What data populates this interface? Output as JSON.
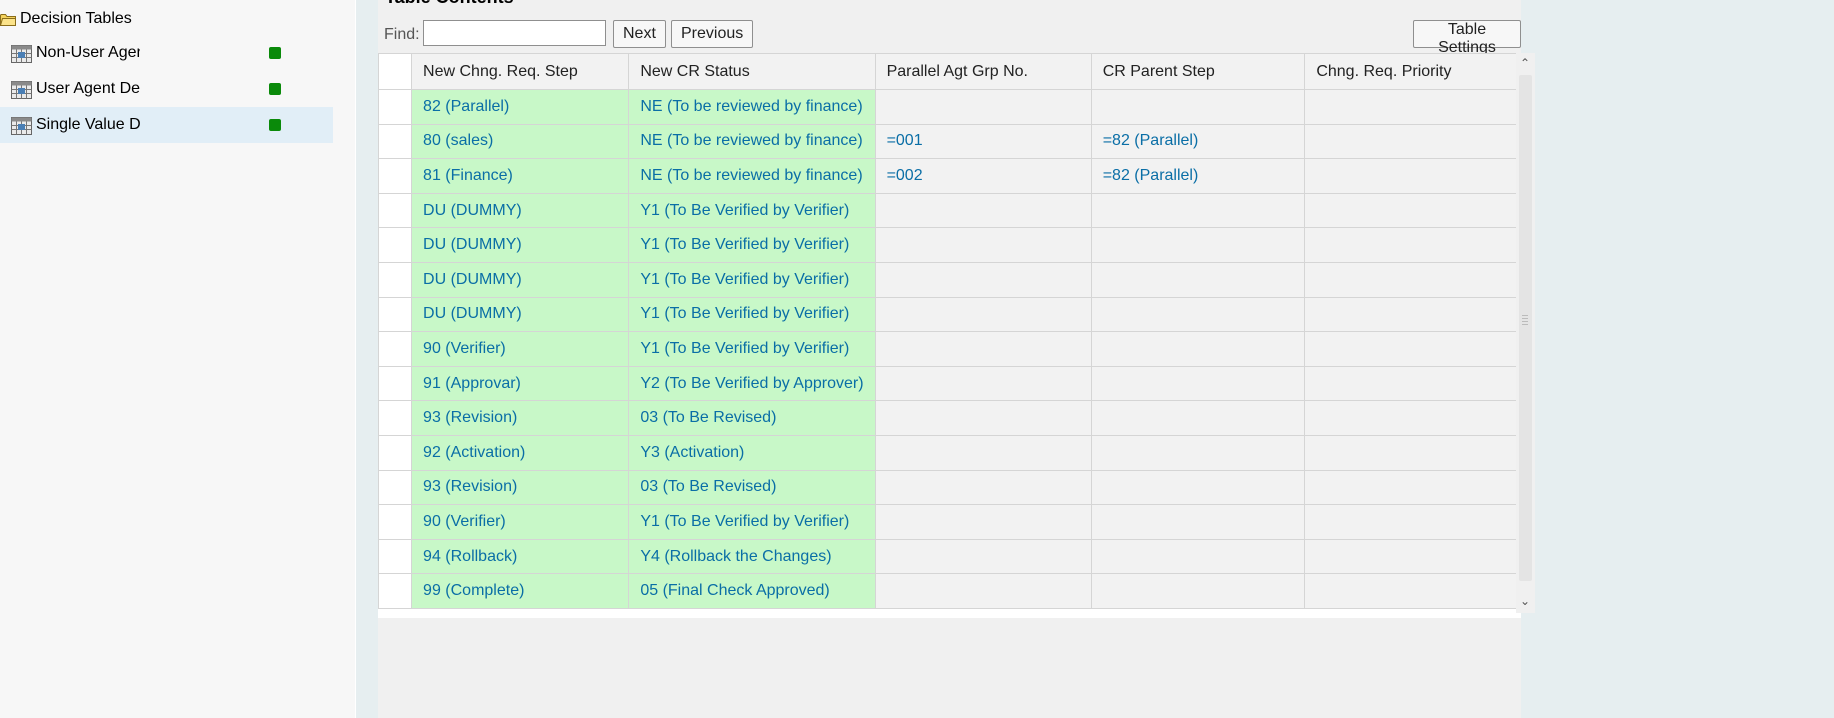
{
  "tree": {
    "root_label": "Decision Tables",
    "items": [
      {
        "label": "Non-User Agent Decision Table",
        "status_color": "#0a8a0a"
      },
      {
        "label": "User Agent Decision Table",
        "status_color": "#0a8a0a"
      },
      {
        "label": "Single Value Decision Table",
        "status_color": "#0a8a0a"
      }
    ]
  },
  "content": {
    "title": "Table Contents",
    "find_label": "Find:",
    "find_value": "",
    "next_label": "Next",
    "previous_label": "Previous",
    "settings_label": "Table Settings"
  },
  "table": {
    "headers": [
      "New Chng. Req. Step",
      "New CR Status",
      "Parallel Agt Grp No.",
      "CR Parent Step",
      "Chng. Req. Priority"
    ],
    "rows": [
      [
        "82 (Parallel)",
        "NE (To be reviewed by finance)",
        "",
        "",
        ""
      ],
      [
        "80 (sales)",
        "NE (To be reviewed by finance)",
        "=001",
        "=82 (Parallel)",
        ""
      ],
      [
        "81 (Finance)",
        "NE (To be reviewed by finance)",
        "=002",
        "=82 (Parallel)",
        ""
      ],
      [
        "DU (DUMMY)",
        "Y1 (To Be Verified by Verifier)",
        "",
        "",
        ""
      ],
      [
        "DU (DUMMY)",
        "Y1 (To Be Verified by Verifier)",
        "",
        "",
        ""
      ],
      [
        "DU (DUMMY)",
        "Y1 (To Be Verified by Verifier)",
        "",
        "",
        ""
      ],
      [
        "DU (DUMMY)",
        "Y1 (To Be Verified by Verifier)",
        "",
        "",
        ""
      ],
      [
        "90 (Verifier)",
        "Y1 (To Be Verified by Verifier)",
        "",
        "",
        ""
      ],
      [
        "91 (Approvar)",
        "Y2 (To Be Verified by Approver)",
        "",
        "",
        ""
      ],
      [
        "93 (Revision)",
        "03 (To Be Revised)",
        "",
        "",
        ""
      ],
      [
        "92 (Activation)",
        "Y3 (Activation)",
        "",
        "",
        ""
      ],
      [
        "93 (Revision)",
        "03 (To Be Revised)",
        "",
        "",
        ""
      ],
      [
        "90 (Verifier)",
        "Y1 (To Be Verified by Verifier)",
        "",
        "",
        ""
      ],
      [
        "94 (Rollback)",
        "Y4 (Rollback the Changes)",
        "",
        "",
        ""
      ],
      [
        "99 (Complete)",
        "05 (Final Check Approved)",
        "",
        "",
        ""
      ]
    ]
  },
  "colors": {
    "condition_cell": "#c8f8c8",
    "link_text": "#0a6ea6",
    "status_ok": "#0a8a0a"
  }
}
